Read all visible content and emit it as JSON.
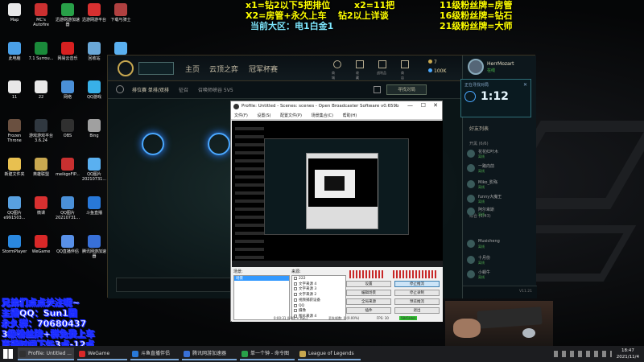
{
  "overlays": {
    "top_left": [
      "x1=钻2以下5把排位",
      "X2=房管+永久上车",
      "当前大区：电1白金1"
    ],
    "top_mid": [
      "x2=11把",
      "钻2以上详谈"
    ],
    "top_right": [
      "11级粉丝牌=房管",
      "16级粉丝牌=钻石",
      "21级粉丝牌=大师"
    ],
    "bottom_left": [
      "兄弟们点点关注呢~",
      "主播QQ：Sun1圆",
      "永久群：70680437",
      "3级粉丝牌+群免费上车",
      "直播时间下午3点-12点"
    ]
  },
  "desktop_icons": [
    {
      "label": "Map",
      "color": "#e8e8e8"
    },
    {
      "label": "MC's Autofire",
      "color": "#cc3030"
    },
    {
      "label": "迅游网游加速器",
      "color": "#28a048"
    },
    {
      "label": "迅游网游平台",
      "color": "#d83030"
    },
    {
      "label": "下载与骑士",
      "color": "#b04040"
    },
    {
      "label": "此电脑",
      "color": "#4aa0e8"
    },
    {
      "label": "7.1 Surrou...",
      "color": "#1a8a3a"
    },
    {
      "label": "网易云音乐",
      "color": "#d82020"
    },
    {
      "label": "回收站",
      "color": "#6aa8d8"
    },
    {
      "label": "腾讯QQ",
      "color": "#5ab0f0"
    },
    {
      "label": "11",
      "color": "#e8e8e8"
    },
    {
      "label": "22",
      "color": "#e8e8e8"
    },
    {
      "label": "网络",
      "color": "#4a90d8"
    },
    {
      "label": "QQ游戏",
      "color": "#38b0e8"
    },
    {
      "label": "网易有道",
      "color": "#d83030"
    },
    {
      "label": "Frozen Throne",
      "color": "#6a5040"
    },
    {
      "label": "游戏游戏平台 3.6.24",
      "color": "#303840"
    },
    {
      "label": "OBS",
      "color": "#303030"
    },
    {
      "label": "Bing",
      "color": "#a0a0a0"
    },
    {
      "label": "扫描游戏库",
      "color": "#d84848"
    },
    {
      "label": "新建文件夹",
      "color": "#e8c050"
    },
    {
      "label": "英雄联盟",
      "color": "#c8a850"
    },
    {
      "label": "meikgoFlP...",
      "color": "#c83030"
    },
    {
      "label": "QQ图片20210731...",
      "color": "#5ab0f0"
    },
    {
      "label": "微信",
      "color": "#28b848"
    },
    {
      "label": "QQ图片 e991503...",
      "color": "#58a0e0"
    },
    {
      "label": "微课",
      "color": "#d83030"
    },
    {
      "label": "QQ图片 20210731...",
      "color": "#4a90d8"
    },
    {
      "label": "斗鱼直播",
      "color": "#2878d8"
    },
    {
      "label": "QQ游戏",
      "color": "#e8b030"
    },
    {
      "label": "StormPlayer",
      "color": "#2a88e0"
    },
    {
      "label": "WeGame",
      "color": "#d82828"
    },
    {
      "label": "QQ直播伴侣",
      "color": "#5890e8"
    },
    {
      "label": "腾讯网游加速器",
      "color": "#3870d8"
    },
    {
      "label": "斗鱼QQ",
      "color": "#e84848"
    }
  ],
  "lol": {
    "nav": [
      "主页",
      "云顶之弈",
      "冠军杯赛"
    ],
    "sub": [
      "排位赛 单排/双排",
      "征召",
      "召唤师峡谷 5V5"
    ],
    "stats": [
      "7",
      "100K"
    ],
    "nav_icons": [
      "商城",
      "收藏",
      "战利品",
      "商店"
    ],
    "summoner": "HerrMozart",
    "status": "在线",
    "queue_label": "正在寻找对局",
    "queue_time": "1:12",
    "find_match": "寻找对局",
    "social": "好友列表",
    "groups": [
      "开黑 (6/6)",
      "综合 (1/43)"
    ],
    "friends": [
      {
        "name": "花花红叶木",
        "status": "离线"
      },
      {
        "name": "一路向前",
        "status": "离线"
      },
      {
        "name": "Miko_影殇",
        "status": "离线"
      },
      {
        "name": "funny大魔王",
        "status": "离线"
      },
      {
        "name": "阿尔卑斯",
        "status": "离线"
      },
      {
        "name": "Musicheng",
        "status": "离线"
      },
      {
        "name": "十月份",
        "status": "离线"
      },
      {
        "name": "小蜗牛",
        "status": "离线"
      }
    ],
    "chat_version": "V11.21"
  },
  "obs": {
    "title": "Profile: Untitled - Scenes: scenes - Open Broadcaster Software v0.659b",
    "menu": [
      "文件(F)",
      "设置(S)",
      "配置文件(P)",
      "场景集合(C)",
      "帮助(H)"
    ],
    "scenes_label": "场景:",
    "sources_label": "来源:",
    "scene_selected": "场景",
    "sources": [
      "222",
      "文字来源 4",
      "文字来源 3",
      "文字来源 2",
      "视频捕获设备",
      "QQ",
      "摄像",
      "图片来源 4"
    ],
    "buttons": [
      "设置",
      "停止推流",
      "编辑场景",
      "停止录制",
      "全局来源",
      "预览推流",
      "插件",
      "退出"
    ],
    "status": [
      "0:00:31 (LIVE + REC)",
      "丢失帧数: 0 (0.00%)",
      "FPS: 30",
      "5841kb/s"
    ]
  },
  "taskbar": {
    "tasks": [
      {
        "label": "Profile: Untitled ...",
        "color": "#303030",
        "state": "active"
      },
      {
        "label": "WeGame",
        "color": "#d82828",
        "state": "open"
      },
      {
        "label": "斗鱼直播伴侣",
        "color": "#2878d8",
        "state": "open"
      },
      {
        "label": "腾讯网游加速器",
        "color": "#3870d8",
        "state": "open"
      },
      {
        "label": "单一个钟 - 命令图",
        "color": "#28a048",
        "state": "open"
      },
      {
        "label": "League of Legends",
        "color": "#c8a850",
        "state": "open"
      }
    ],
    "time": "18:47",
    "date": "2021/11/4"
  }
}
